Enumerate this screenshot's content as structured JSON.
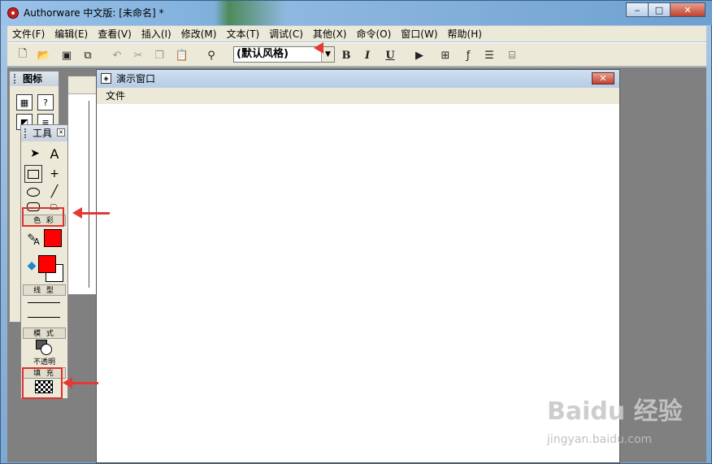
{
  "window": {
    "title": "Authorware 中文版: [未命名] *",
    "minimize": "‒",
    "maximize": "□",
    "close": "✕"
  },
  "menu": {
    "items": [
      "文件(F)",
      "编辑(E)",
      "查看(V)",
      "插入(I)",
      "修改(M)",
      "文本(T)",
      "调试(C)",
      "其他(X)",
      "命令(O)",
      "窗口(W)",
      "帮助(H)"
    ]
  },
  "toolbar": {
    "style_value": "(默认风格)",
    "bold": "B",
    "italic": "I",
    "underline": "U"
  },
  "icon_palette": {
    "title": "图标"
  },
  "presentation_window": {
    "title": "演示窗口",
    "menu_file": "文件",
    "close": "✕"
  },
  "tools_palette": {
    "title": "工具",
    "color_label": "色 彩",
    "line_label": "线 型",
    "mode_label": "模 式",
    "mode_value": "不透明",
    "fill_label": "填 充",
    "text_tool": "A",
    "pen_text": "A"
  },
  "colors": {
    "line_color": "#ff0000",
    "fill_fg_color": "#ff0000",
    "annotation": "#e53935"
  },
  "watermark": {
    "main": "Baidu 经验",
    "sub": "jingyan.baidu.com"
  }
}
